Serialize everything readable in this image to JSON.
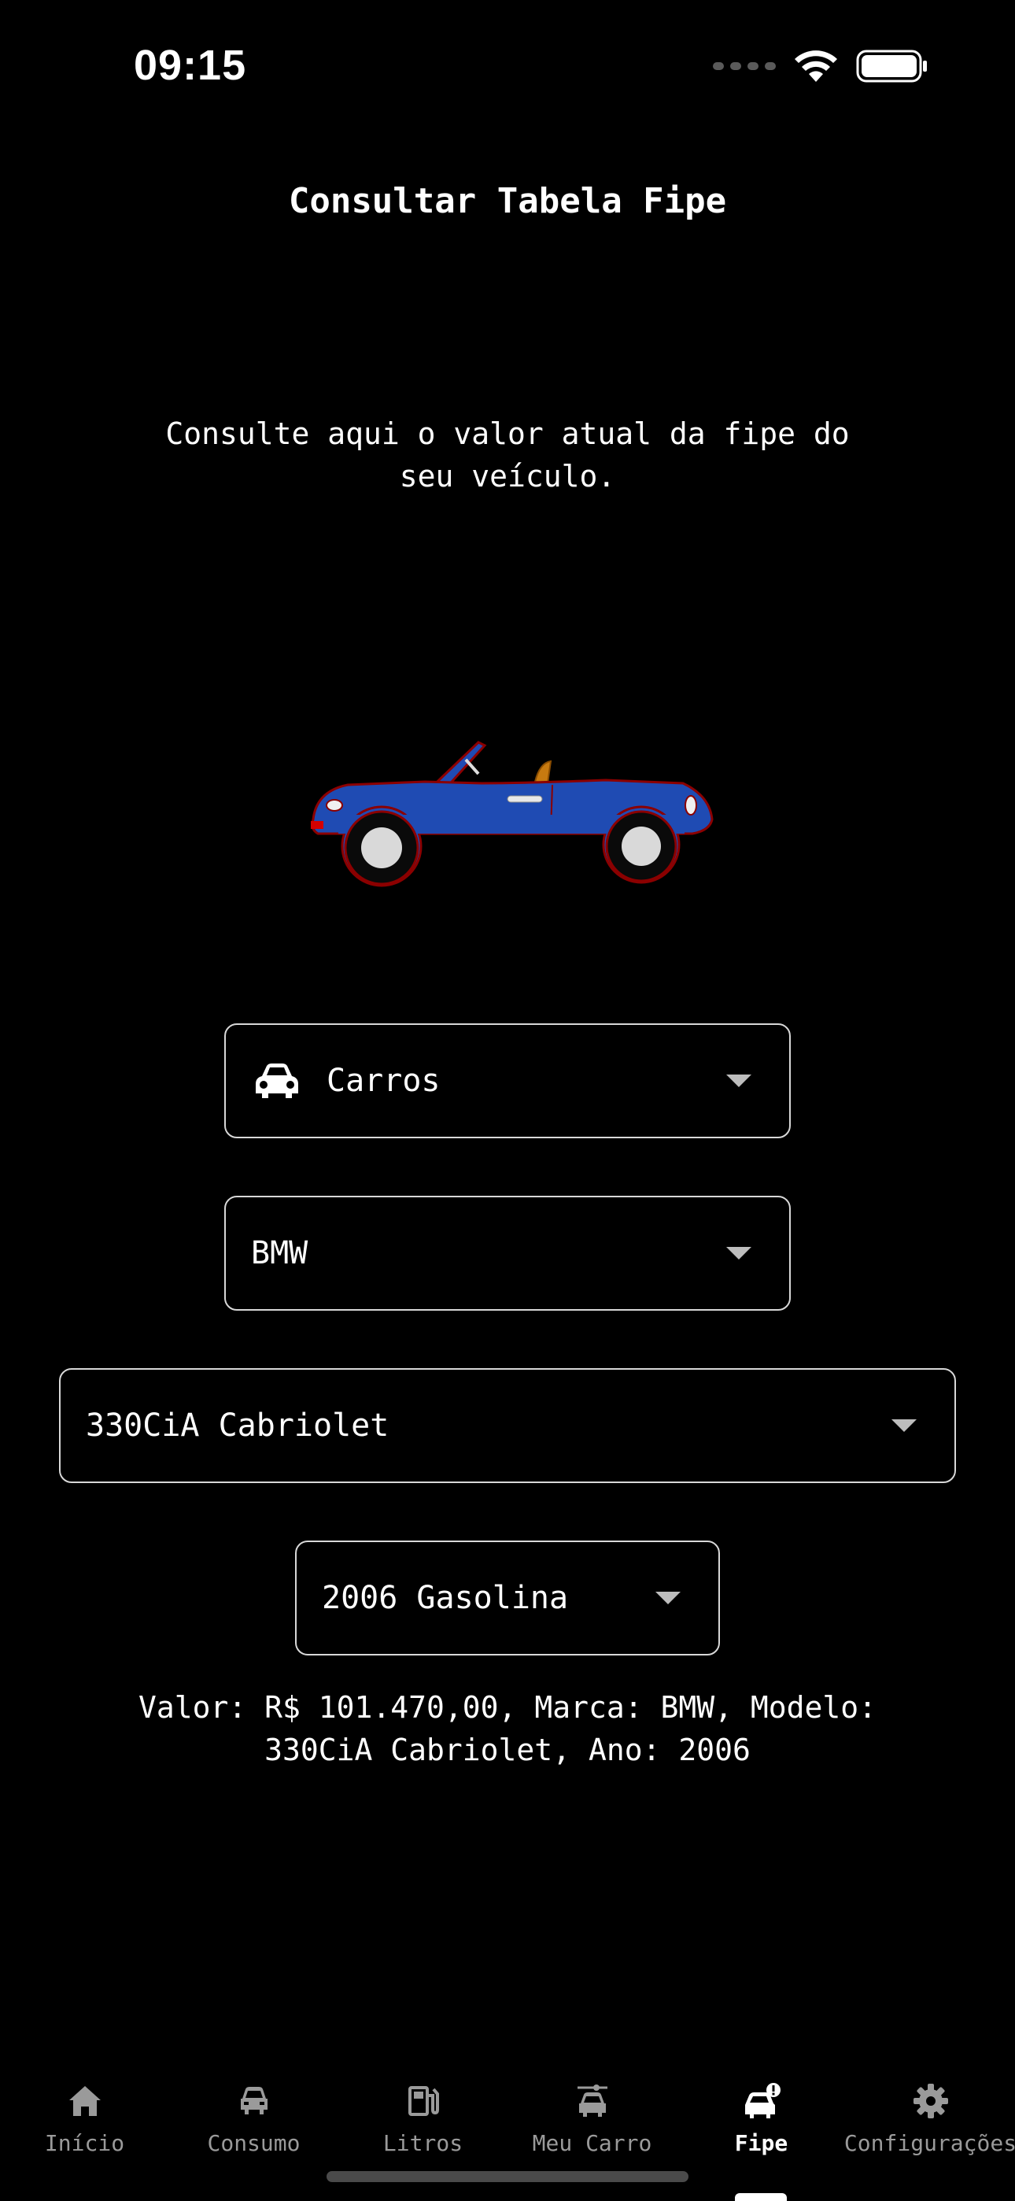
{
  "status_bar": {
    "time": "09:15",
    "icons": [
      "signal-icon",
      "wifi-icon",
      "battery-icon"
    ]
  },
  "header": {
    "title": "Consultar Tabela Fipe"
  },
  "intro": {
    "text": "Consulte aqui o valor atual da fipe do seu veículo."
  },
  "illustration": {
    "icon": "convertible-car-illustration",
    "body_color": "#1f4bb3",
    "outline_color": "#8b0000"
  },
  "filters": {
    "vehicle_type": {
      "value": "Carros",
      "icon": "car-icon"
    },
    "brand": {
      "value": "BMW"
    },
    "model": {
      "value": "330CiA Cabriolet"
    },
    "year": {
      "value": "2006 Gasolina"
    }
  },
  "result": {
    "text": "Valor: R$ 101.470,00, Marca: BMW, Modelo: 330CiA Cabriolet, Ano: 2006"
  },
  "tabs": [
    {
      "label": "Início",
      "icon": "home-icon",
      "active": false
    },
    {
      "label": "Consumo",
      "icon": "car-front-icon",
      "active": false
    },
    {
      "label": "Litros",
      "icon": "fuel-pump-icon",
      "active": false
    },
    {
      "label": "Meu Carro",
      "icon": "car-settings-icon",
      "active": false
    },
    {
      "label": "Fipe",
      "icon": "car-alert-icon",
      "active": true
    },
    {
      "label": "Configurações",
      "icon": "gear-icon",
      "active": false
    }
  ],
  "colors": {
    "background": "#000000",
    "text": "#ffffff",
    "inactive_tab": "#9a9a9a",
    "border": "#d8d8d8"
  }
}
